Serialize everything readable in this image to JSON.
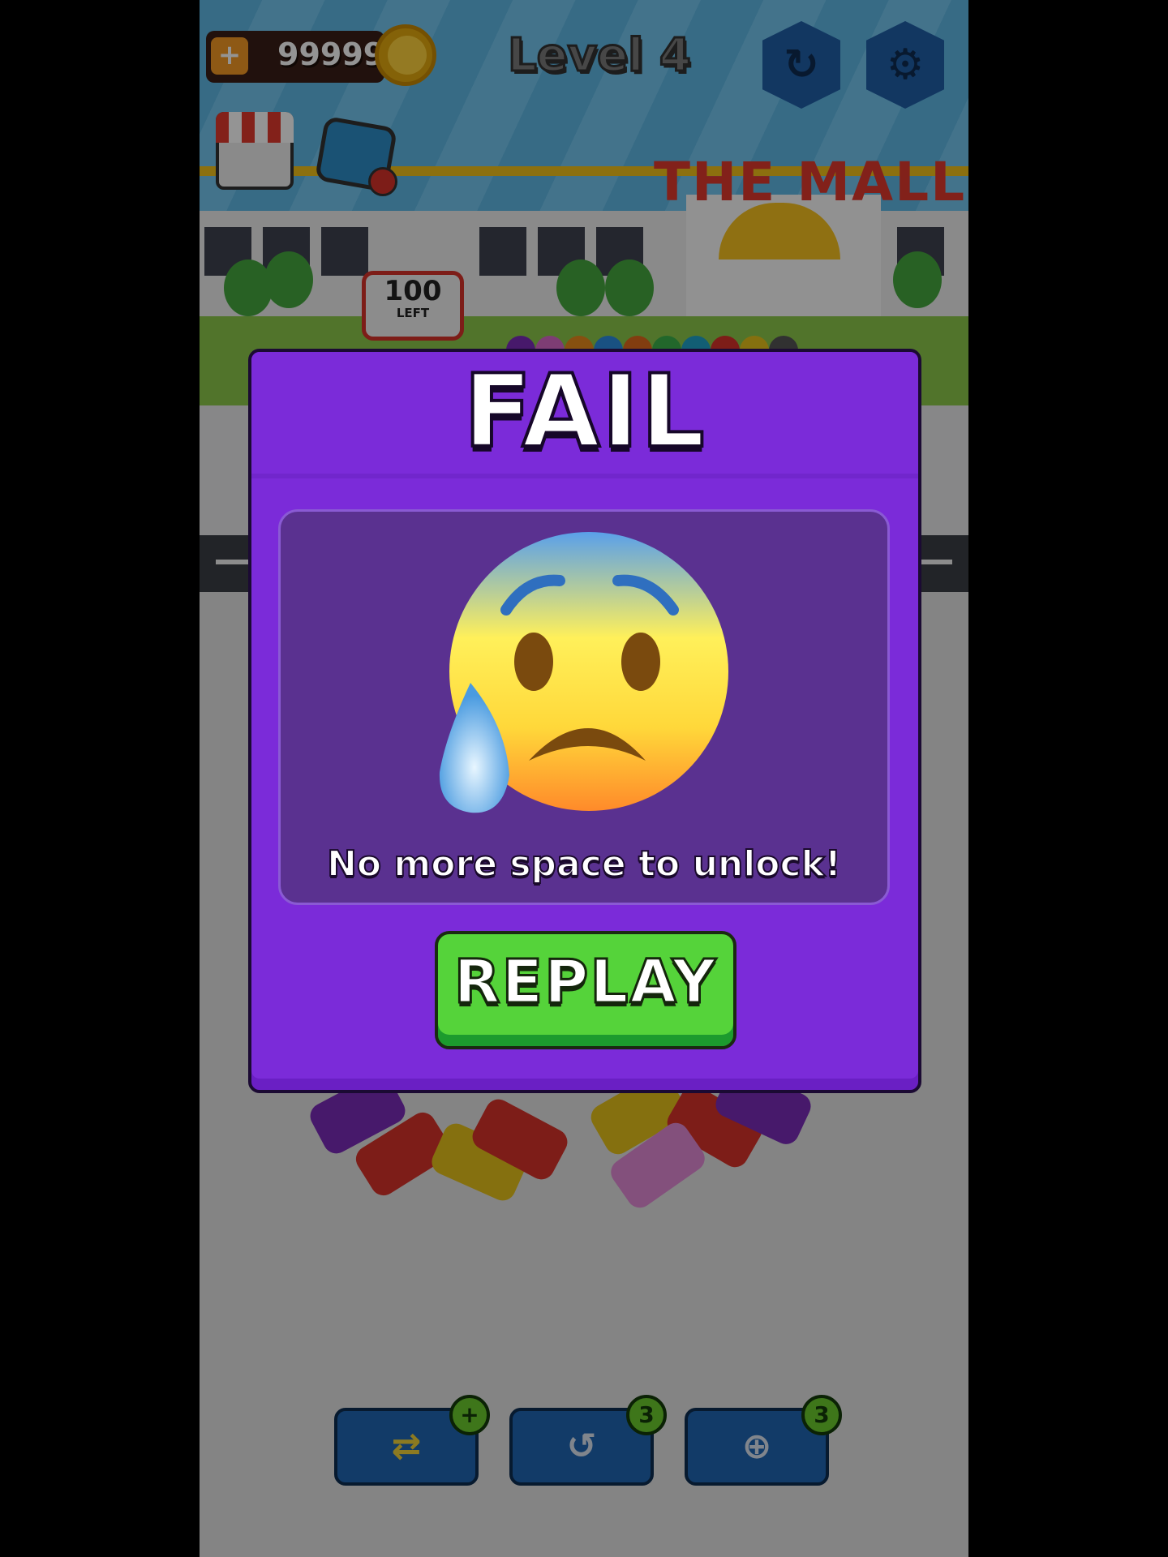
{
  "hud": {
    "coins": "99999",
    "level": "Level 4",
    "left_count": "100",
    "left_label": "LEFT",
    "mall_sign": "THE MALL"
  },
  "boosters": [
    {
      "name": "swap-passenger",
      "badge": "+"
    },
    {
      "name": "shuffle-cars",
      "badge": "3"
    },
    {
      "name": "add-parking-spot",
      "badge": "3"
    }
  ],
  "modal": {
    "title": "FAIL",
    "message": "No more space to unlock!",
    "button": "REPLAY",
    "emoji": "anxious-face-with-sweat"
  },
  "colors": {
    "modal_bg": "#7b2bd9",
    "panel_bg": "#5a3190",
    "replay_green": "#55d33a",
    "hud_blue": "#1f5fa8"
  }
}
